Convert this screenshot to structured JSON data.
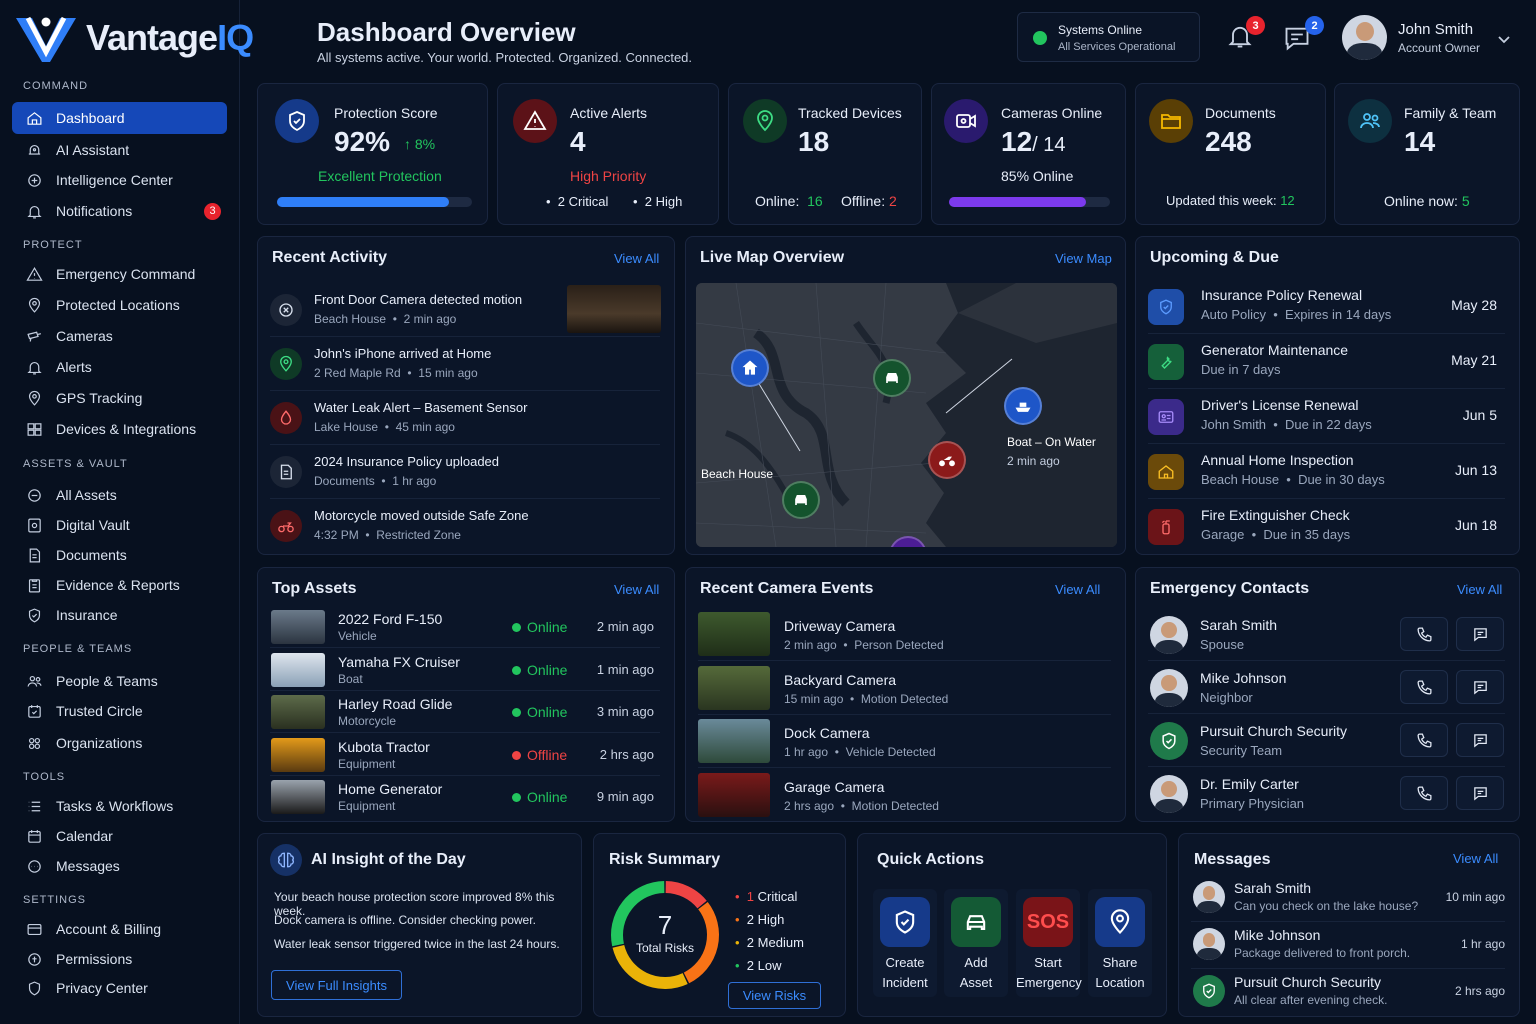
{
  "brand": {
    "name_main": "Vantage",
    "name_accent": "IQ"
  },
  "sidebar": {
    "sections": [
      {
        "title": "COMMAND",
        "items": [
          {
            "label": "Dashboard",
            "icon": "dashboard-icon",
            "active": true
          },
          {
            "label": "AI Assistant",
            "icon": "ai-assistant-icon"
          },
          {
            "label": "Intelligence Center",
            "icon": "intelligence-icon"
          },
          {
            "label": "Notifications",
            "icon": "bell-icon",
            "badge": "3"
          }
        ]
      },
      {
        "title": "PROTECT",
        "items": [
          {
            "label": "Emergency Command",
            "icon": "warning-icon"
          },
          {
            "label": "Protected Locations",
            "icon": "location-pin-icon"
          },
          {
            "label": "Cameras",
            "icon": "camera-icon"
          },
          {
            "label": "Alerts",
            "icon": "bell-icon"
          },
          {
            "label": "GPS Tracking",
            "icon": "gps-icon"
          },
          {
            "label": "Devices & Integrations",
            "icon": "devices-icon"
          }
        ]
      },
      {
        "title": "ASSETS & VAULT",
        "items": [
          {
            "label": "All Assets",
            "icon": "assets-icon"
          },
          {
            "label": "Digital Vault",
            "icon": "vault-icon"
          },
          {
            "label": "Documents",
            "icon": "document-icon"
          },
          {
            "label": "Evidence & Reports",
            "icon": "reports-icon"
          },
          {
            "label": "Insurance",
            "icon": "shield-icon"
          }
        ]
      },
      {
        "title": "PEOPLE & TEAMS",
        "items": [
          {
            "label": "People & Teams",
            "icon": "people-icon"
          },
          {
            "label": "Trusted Circle",
            "icon": "trusted-icon"
          },
          {
            "label": "Organizations",
            "icon": "organizations-icon"
          }
        ]
      },
      {
        "title": "TOOLS",
        "items": [
          {
            "label": "Tasks & Workflows",
            "icon": "tasks-icon"
          },
          {
            "label": "Calendar",
            "icon": "calendar-icon"
          },
          {
            "label": "Messages",
            "icon": "messages-icon"
          }
        ]
      },
      {
        "title": "SETTINGS",
        "items": [
          {
            "label": "Account & Billing",
            "icon": "billing-icon"
          },
          {
            "label": "Permissions",
            "icon": "permissions-icon"
          },
          {
            "label": "Privacy Center",
            "icon": "privacy-icon"
          }
        ]
      }
    ]
  },
  "header": {
    "title": "Dashboard Overview",
    "subtitle": "All systems active. Your world. Protected. Organized. Connected.",
    "status_title": "Systems Online",
    "status_sub": "All Services Operational",
    "notif_count": "3",
    "msg_count": "2",
    "user_name": "John Smith",
    "user_role": "Account Owner"
  },
  "stats": {
    "protection": {
      "label": "Protection Score",
      "value": "92%",
      "delta": "8%",
      "status": "Excellent Protection",
      "progress": 0.88
    },
    "alerts": {
      "label": "Active Alerts",
      "value": "4",
      "priority": "High Priority",
      "critical": "2 Critical",
      "high": "2 High"
    },
    "devices": {
      "label": "Tracked Devices",
      "value": "18",
      "online_label": "Online:",
      "online": "16",
      "offline_label": "Offline:",
      "offline": "2"
    },
    "cameras": {
      "label": "Cameras Online",
      "value": "12",
      "total": "/ 14",
      "pct": "85% Online",
      "progress": 0.85
    },
    "documents": {
      "label": "Documents",
      "value": "248",
      "updated_label": "Updated this week:",
      "updated": "12"
    },
    "family": {
      "label": "Family & Team",
      "value": "14",
      "online_label": "Online now:",
      "online": "5"
    }
  },
  "activity": {
    "title": "Recent Activity",
    "view": "View All",
    "items": [
      {
        "title": "Front Door Camera detected motion",
        "place": "Beach House",
        "time": "2 min ago",
        "icon": "motion-icon"
      },
      {
        "title": "John's iPhone arrived at Home",
        "place": "2 Red Maple Rd",
        "time": "15 min ago",
        "icon": "location-pin-icon"
      },
      {
        "title": "Water Leak Alert – Basement Sensor",
        "place": "Lake House",
        "time": "45 min ago",
        "icon": "water-drop-icon"
      },
      {
        "title": "2024 Insurance Policy uploaded",
        "place": "Documents",
        "time": "1 hr ago",
        "icon": "document-icon"
      },
      {
        "title": "Motorcycle moved outside Safe Zone",
        "place": "4:32 PM",
        "time": "Restricted Zone",
        "icon": "motorcycle-icon"
      }
    ]
  },
  "map": {
    "title": "Live Map Overview",
    "view": "View Map",
    "beach_label": "Beach House",
    "boat_label": "Boat – On Water",
    "boat_time": "2 min ago"
  },
  "upcoming": {
    "title": "Upcoming & Due",
    "items": [
      {
        "title": "Insurance Policy Renewal",
        "sub1": "Auto Policy",
        "sub2": "Expires in 14 days",
        "date": "May 28",
        "icon": "shield-icon",
        "color": "#1f4ea8"
      },
      {
        "title": "Generator Maintenance",
        "sub1": "Due in 7 days",
        "sub2": "",
        "date": "May 21",
        "icon": "wrench-icon",
        "color": "#15603a"
      },
      {
        "title": "Driver's License Renewal",
        "sub1": "John Smith",
        "sub2": "Due in 22 days",
        "date": "Jun 5",
        "icon": "id-card-icon",
        "color": "#3b2a8a"
      },
      {
        "title": "Annual Home Inspection",
        "sub1": "Beach House",
        "sub2": "Due in 30 days",
        "date": "Jun 13",
        "icon": "home-icon",
        "color": "#6b4a0a"
      },
      {
        "title": "Fire Extinguisher Check",
        "sub1": "Garage",
        "sub2": "Due in 35 days",
        "date": "Jun 18",
        "icon": "fire-extinguisher-icon",
        "color": "#6b1418"
      }
    ]
  },
  "assets": {
    "title": "Top Assets",
    "view": "View All",
    "items": [
      {
        "name": "2022 Ford F-150",
        "type": "Vehicle",
        "status": "Online",
        "time": "2 min ago"
      },
      {
        "name": "Yamaha FX Cruiser",
        "type": "Boat",
        "status": "Online",
        "time": "1 min ago"
      },
      {
        "name": "Harley Road Glide",
        "type": "Motorcycle",
        "status": "Online",
        "time": "3 min ago"
      },
      {
        "name": "Kubota Tractor",
        "type": "Equipment",
        "status": "Offline",
        "time": "2 hrs ago"
      },
      {
        "name": "Home Generator",
        "type": "Equipment",
        "status": "Online",
        "time": "9 min ago"
      }
    ]
  },
  "camera_events": {
    "title": "Recent Camera Events",
    "view": "View All",
    "items": [
      {
        "name": "Driveway Camera",
        "time": "2 min ago",
        "event": "Person Detected"
      },
      {
        "name": "Backyard Camera",
        "time": "15 min ago",
        "event": "Motion Detected"
      },
      {
        "name": "Dock Camera",
        "time": "1 hr ago",
        "event": "Vehicle Detected"
      },
      {
        "name": "Garage Camera",
        "time": "2 hrs ago",
        "event": "Motion Detected"
      }
    ]
  },
  "contacts": {
    "title": "Emergency Contacts",
    "view": "View All",
    "items": [
      {
        "name": "Sarah Smith",
        "role": "Spouse"
      },
      {
        "name": "Mike Johnson",
        "role": "Neighbor"
      },
      {
        "name": "Pursuit Church Security",
        "role": "Security Team"
      },
      {
        "name": "Dr. Emily Carter",
        "role": "Primary Physician"
      }
    ]
  },
  "insight": {
    "title": "AI Insight of the Day",
    "lines": [
      "Your beach house protection score improved 8% this week.",
      "Dock camera is offline. Consider checking power.",
      "Water leak sensor triggered twice in the last 24 hours."
    ],
    "button": "View Full Insights"
  },
  "risk": {
    "title": "Risk Summary",
    "total": "7",
    "total_label": "Total Risks",
    "items": [
      {
        "count": "1",
        "label": "Critical",
        "color": "#ef4444",
        "value": 1
      },
      {
        "count": "2",
        "label": "High",
        "color": "#f97316",
        "value": 2
      },
      {
        "count": "2",
        "label": "Medium",
        "color": "#eab308",
        "value": 2
      },
      {
        "count": "2",
        "label": "Low",
        "color": "#22c55e",
        "value": 2
      }
    ],
    "button": "View Risks"
  },
  "quick": {
    "title": "Quick Actions",
    "items": [
      {
        "l1": "Create",
        "l2": "Incident",
        "icon": "shield-icon"
      },
      {
        "l1": "Add",
        "l2": "Asset",
        "icon": "car-icon"
      },
      {
        "l1": "Start",
        "l2": "Emergency",
        "icon": "sos-icon",
        "glyph": "SOS"
      },
      {
        "l1": "Share",
        "l2": "Location",
        "icon": "location-pin-icon"
      }
    ]
  },
  "messages": {
    "title": "Messages",
    "view": "View All",
    "items": [
      {
        "name": "Sarah Smith",
        "text": "Can you check on the lake house?",
        "time": "10 min ago"
      },
      {
        "name": "Mike Johnson",
        "text": "Package delivered to front porch.",
        "time": "1 hr ago"
      },
      {
        "name": "Pursuit Church Security",
        "text": "All clear after evening check.",
        "time": "2 hrs ago"
      }
    ]
  }
}
